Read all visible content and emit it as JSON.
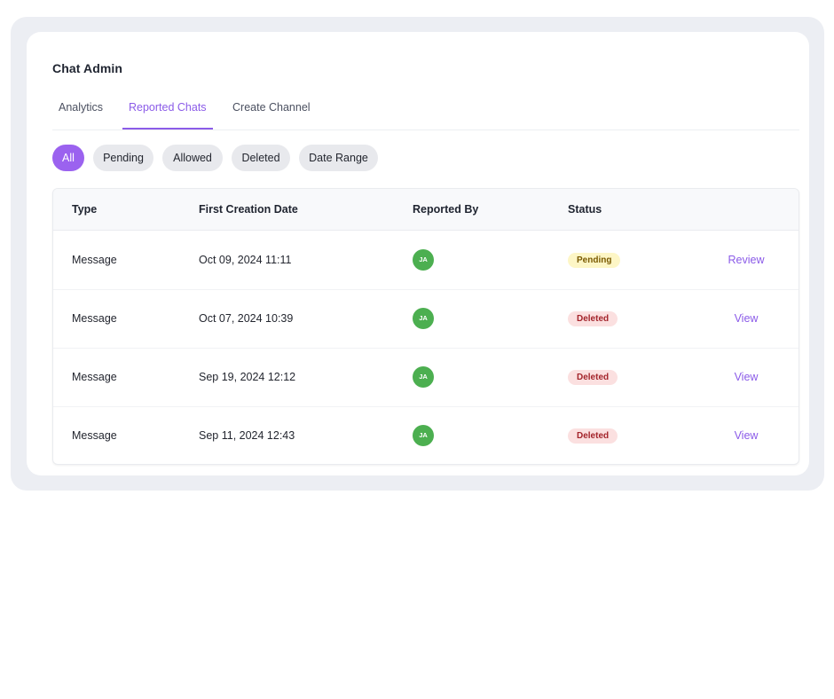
{
  "app": {
    "title": "Chat Admin"
  },
  "tabs": [
    {
      "label": "Analytics",
      "active": false
    },
    {
      "label": "Reported Chats",
      "active": true
    },
    {
      "label": "Create Channel",
      "active": false
    }
  ],
  "filters": [
    {
      "label": "All",
      "active": true
    },
    {
      "label": "Pending",
      "active": false
    },
    {
      "label": "Allowed",
      "active": false
    },
    {
      "label": "Deleted",
      "active": false
    },
    {
      "label": "Date Range",
      "active": false
    }
  ],
  "table": {
    "columns": [
      "Type",
      "First Creation Date",
      "Reported By",
      "Status"
    ],
    "rows": [
      {
        "type": "Message",
        "date": "Oct 09, 2024 11:11",
        "reporter": "JA",
        "status": "Pending",
        "action": "Review"
      },
      {
        "type": "Message",
        "date": "Oct 07, 2024 10:39",
        "reporter": "JA",
        "status": "Deleted",
        "action": "View"
      },
      {
        "type": "Message",
        "date": "Sep 19, 2024 12:12",
        "reporter": "JA",
        "status": "Deleted",
        "action": "View"
      },
      {
        "type": "Message",
        "date": "Sep 11, 2024 12:43",
        "reporter": "JA",
        "status": "Deleted",
        "action": "View"
      }
    ]
  },
  "colors": {
    "accent": "#8b5be8",
    "chip_active": "#9b62ef",
    "avatar": "#4caf50",
    "pending_bg": "#fdf6c6",
    "deleted_bg": "#fbe0e0"
  }
}
